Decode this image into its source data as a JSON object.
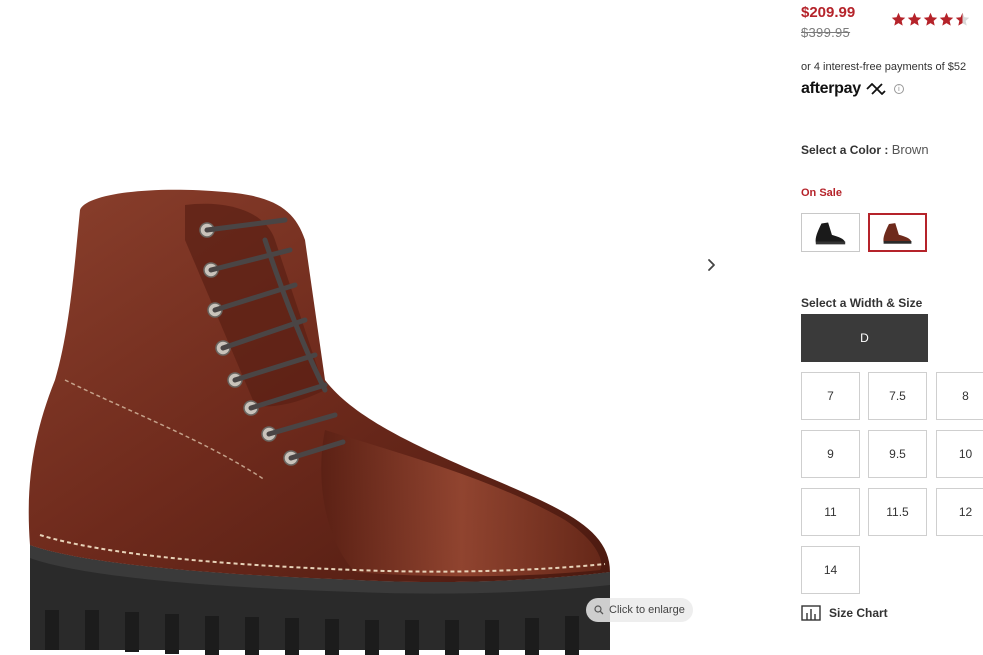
{
  "pricing": {
    "sale_price": "$209.99",
    "original_price": "$399.95",
    "rating_stars": 4.5
  },
  "afterpay": {
    "text": "or 4 interest-free payments of $52",
    "logo": "afterpay",
    "info_icon": "info-icon"
  },
  "color": {
    "label": "Select a Color :",
    "value": "Brown",
    "sale_tag": "On Sale",
    "swatches": [
      {
        "name": "Black",
        "selected": false
      },
      {
        "name": "Brown",
        "selected": true
      }
    ]
  },
  "size": {
    "label": "Select a Width & Size",
    "width": "D",
    "sizes": [
      "7",
      "7.5",
      "8",
      "9",
      "9.5",
      "10",
      "11",
      "11.5",
      "12",
      "14"
    ],
    "size_chart_label": "Size Chart"
  },
  "gallery": {
    "enlarge_label": "Click to enlarge",
    "next_icon": "chevron-right-icon"
  },
  "colors": {
    "accent": "#b5232a",
    "width_selected_bg": "#3a3a3a",
    "star": "#b5232a"
  }
}
